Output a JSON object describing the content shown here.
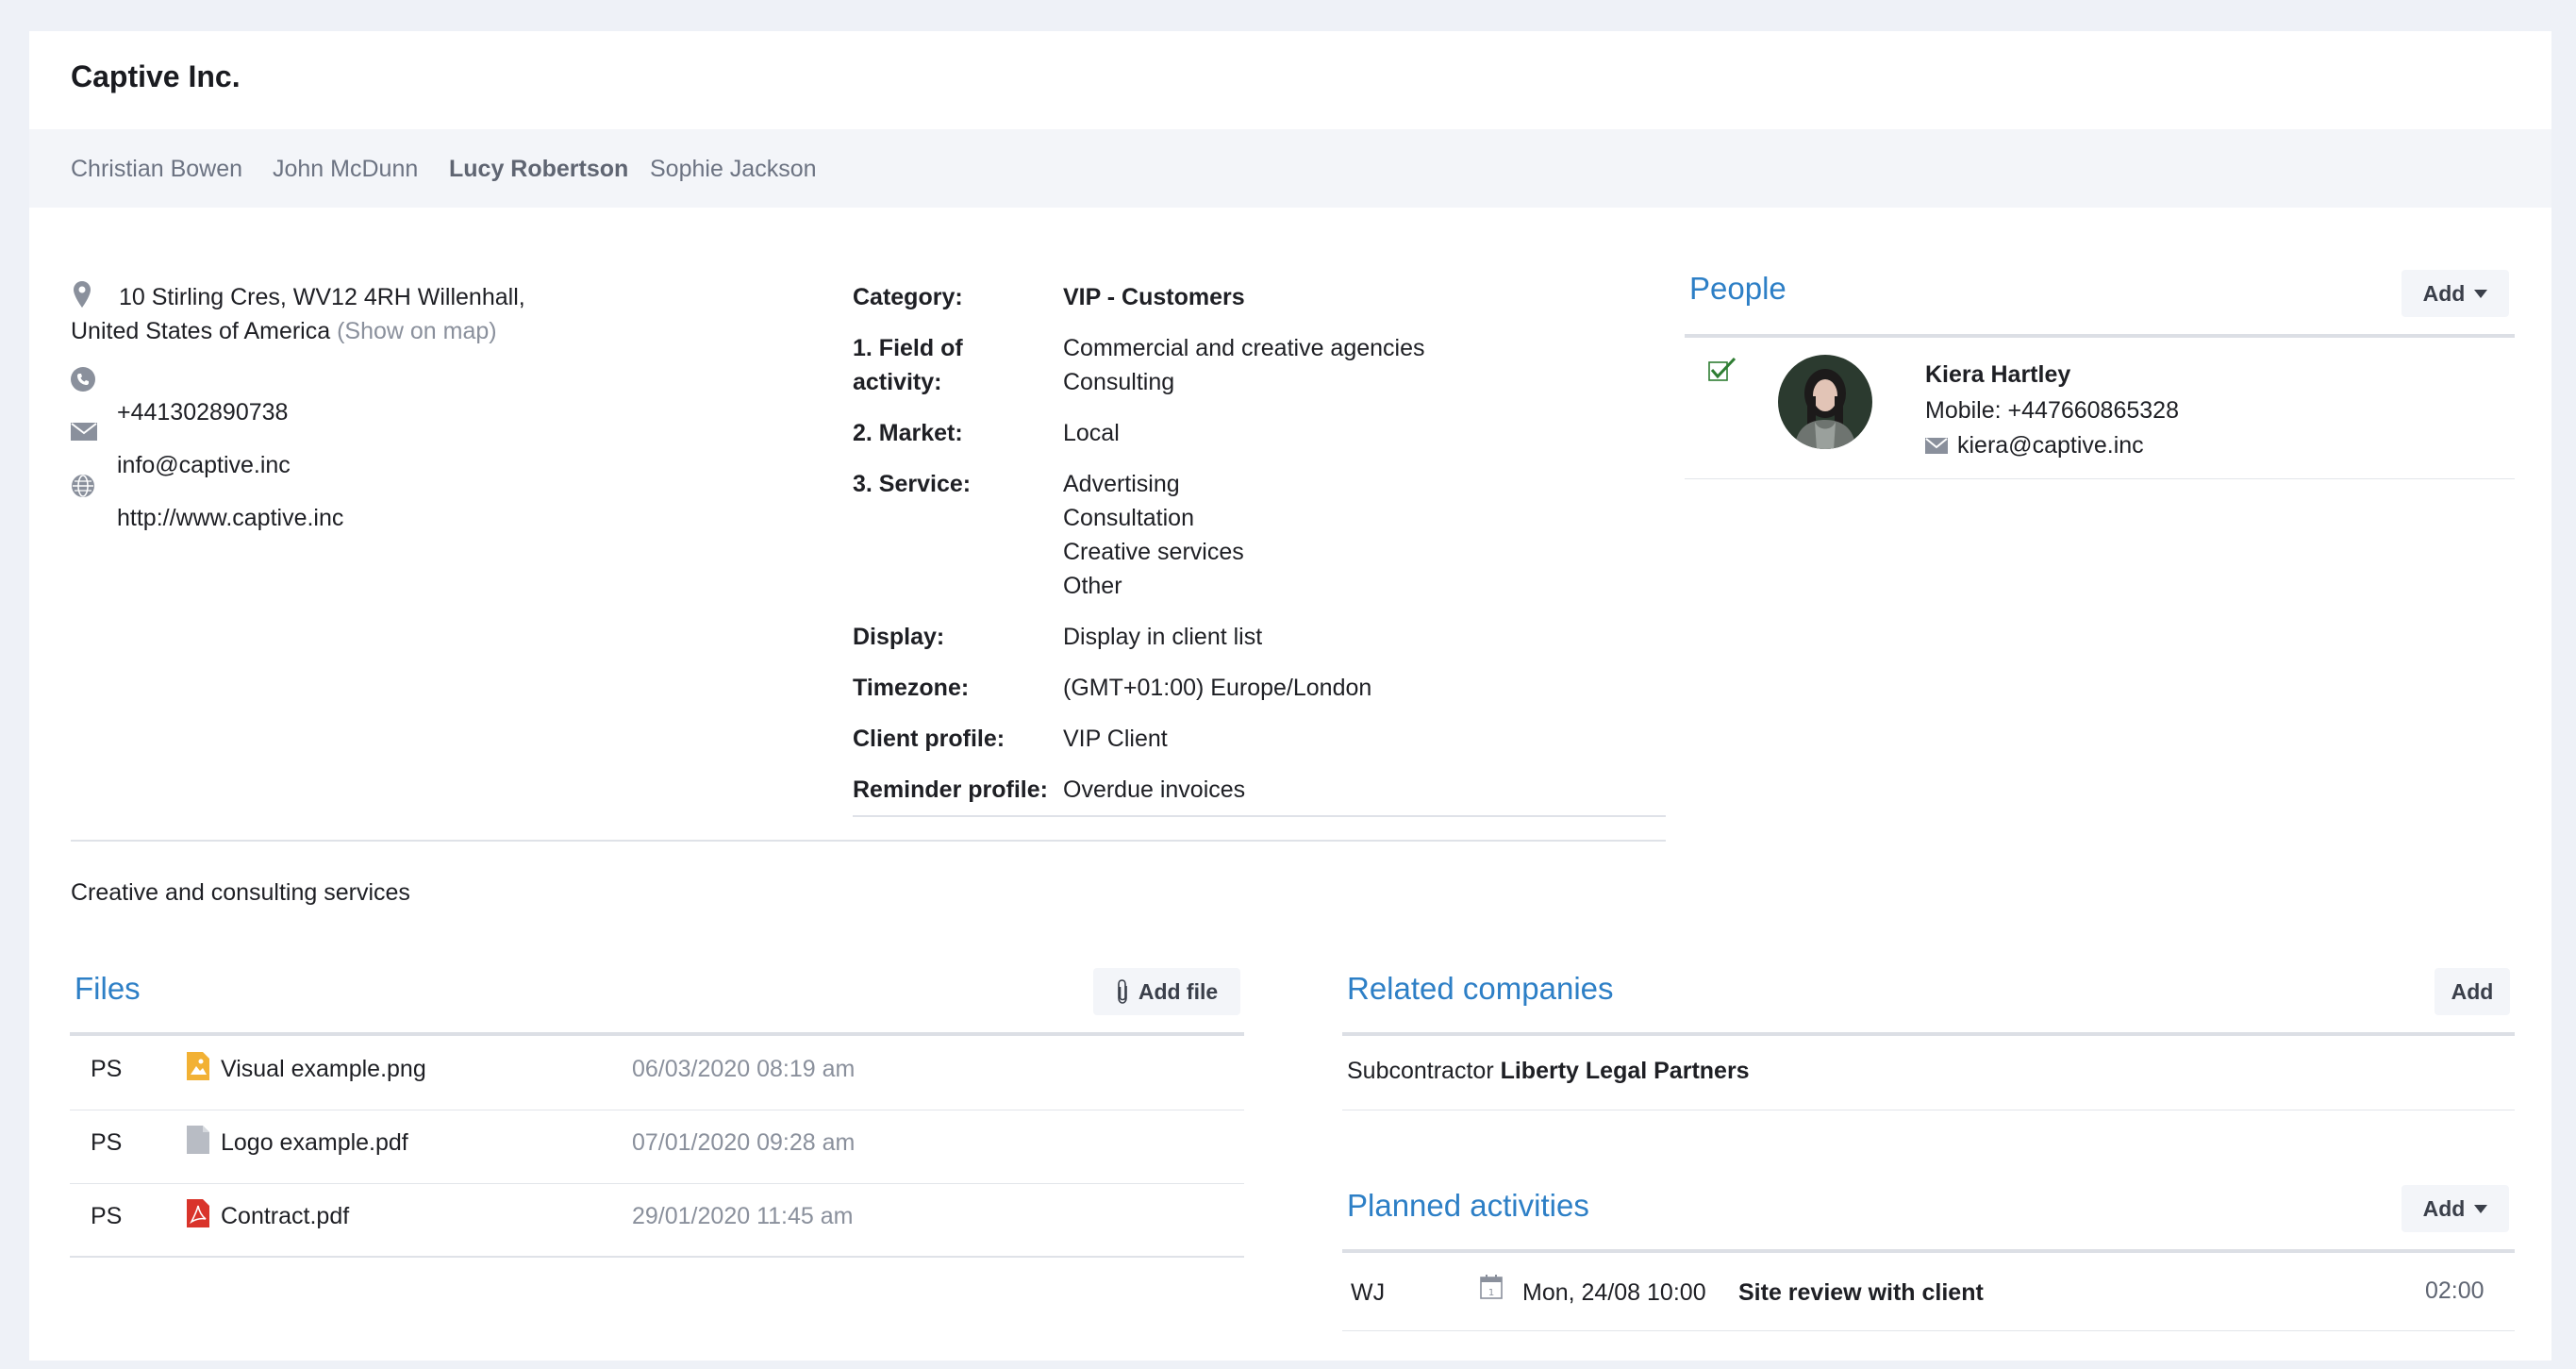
{
  "header": {
    "title": "Captive Inc."
  },
  "tabs": [
    {
      "label": "Christian Bowen",
      "active": false
    },
    {
      "label": "John McDunn",
      "active": false
    },
    {
      "label": "Lucy Robertson",
      "active": true
    },
    {
      "label": "Sophie Jackson",
      "active": false
    }
  ],
  "contact": {
    "address_line1": "10 Stirling Cres, WV12 4RH Willenhall,",
    "address_line2": "United States of America",
    "show_on_map": "(Show on map)",
    "phone": "+441302890738",
    "email": "info@captive.inc",
    "website": "http://www.captive.inc"
  },
  "details": {
    "category_label": "Category:",
    "category_value": "VIP - Customers",
    "field_label_1": "1. Field of",
    "field_label_2": "activity:",
    "field_value_1": "Commercial and creative agencies",
    "field_value_2": "Consulting",
    "market_label": "2. Market:",
    "market_value": "Local",
    "service_label": "3. Service:",
    "service_values": [
      "Advertising",
      "Consultation",
      "Creative services",
      "Other"
    ],
    "display_label": "Display:",
    "display_value": "Display in client list",
    "timezone_label": "Timezone:",
    "timezone_value": "(GMT+01:00) Europe/London",
    "client_profile_label": "Client profile:",
    "client_profile_value": "VIP Client",
    "reminder_profile_label": "Reminder profile:",
    "reminder_profile_value": "Overdue invoices"
  },
  "description": "Creative and consulting services",
  "people": {
    "title": "People",
    "add_label": "Add",
    "person": {
      "name": "Kiera Hartley",
      "mobile": "Mobile: +447660865328",
      "email": "kiera@captive.inc"
    }
  },
  "files": {
    "title": "Files",
    "add_label": "Add file",
    "rows": [
      {
        "initials": "PS",
        "name": "Visual example.png",
        "date": "06/03/2020 08:19 am",
        "type": "image"
      },
      {
        "initials": "PS",
        "name": "Logo example.pdf",
        "date": "07/01/2020 09:28 am",
        "type": "document"
      },
      {
        "initials": "PS",
        "name": "Contract.pdf",
        "date": "29/01/2020 11:45 am",
        "type": "pdf"
      }
    ]
  },
  "related": {
    "title": "Related companies",
    "add_label": "Add",
    "relation": "Subcontractor",
    "company": "Liberty Legal Partners"
  },
  "activities": {
    "title": "Planned activities",
    "add_label": "Add",
    "rows": [
      {
        "initials": "WJ",
        "date": "Mon, 24/08 10:00",
        "title": "Site review with client",
        "duration": "02:00"
      }
    ]
  },
  "icons": {
    "location": "location-pin-icon",
    "phone": "phone-icon",
    "email": "envelope-icon",
    "web": "globe-icon",
    "check": "checkmark-icon",
    "attach": "paperclip-icon",
    "calendar": "calendar-icon"
  },
  "colors": {
    "accent": "#2d7fc6",
    "check": "#2e7d32",
    "image_file": "#f2b134",
    "pdf_file": "#d9342b",
    "doc_file": "#b8bcc4"
  }
}
